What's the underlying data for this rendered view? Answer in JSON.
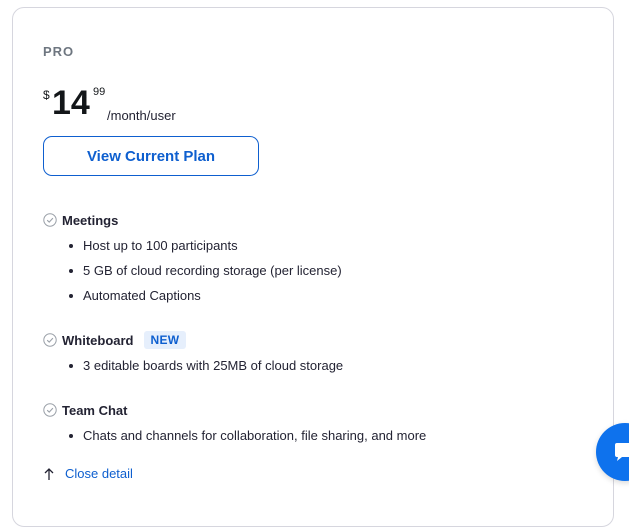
{
  "plan": {
    "name": "PRO",
    "price": {
      "currency": "$",
      "amount": "14",
      "cents": "99",
      "period": "/month/user"
    },
    "view_button_label": "View Current Plan"
  },
  "features": [
    {
      "title": "Meetings",
      "badge": "",
      "items": [
        "Host up to 100 participants",
        "5 GB of cloud recording storage (per license)",
        "Automated Captions"
      ]
    },
    {
      "title": "Whiteboard",
      "badge": "NEW",
      "items": [
        "3 editable boards with 25MB of cloud storage"
      ]
    },
    {
      "title": "Team Chat",
      "badge": "",
      "items": [
        "Chats and channels for collaboration, file sharing, and more"
      ]
    }
  ],
  "close_detail_label": "Close detail",
  "icons": {
    "check": "check-circle-icon",
    "close": "arrow-up-icon",
    "chat": "chat-bubble-icon"
  },
  "colors": {
    "accent": "#0e5fcf",
    "fab": "#0e72ed",
    "badge_bg": "#e6effc"
  }
}
